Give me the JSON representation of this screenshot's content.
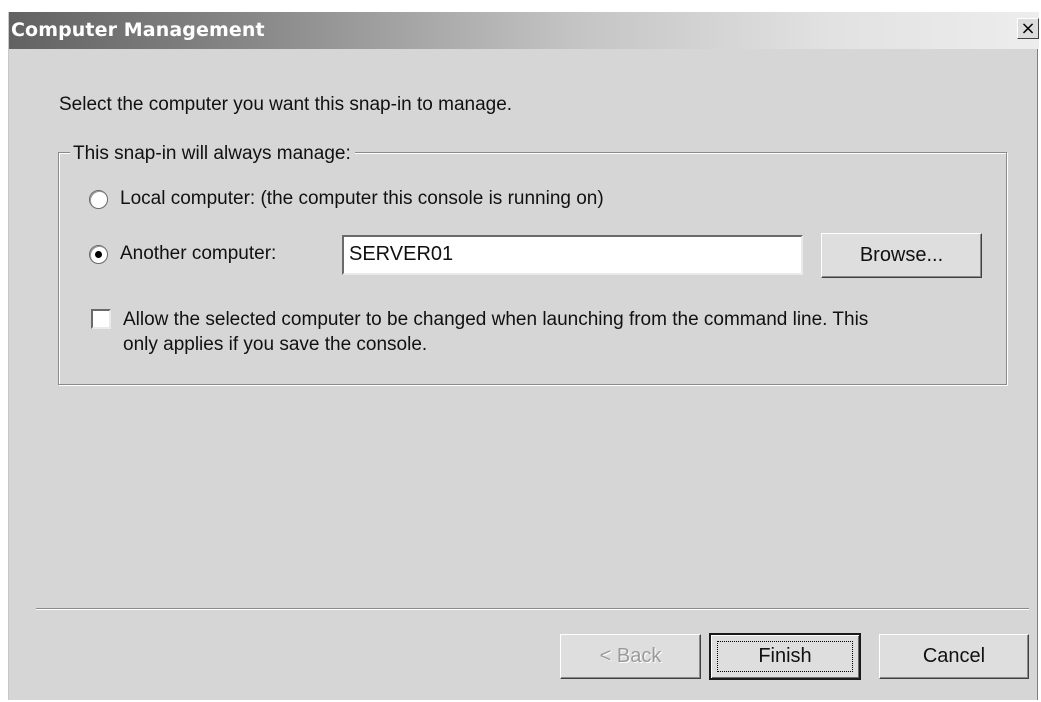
{
  "window": {
    "title": "Computer Management",
    "close_glyph": "×"
  },
  "instruction": "Select the computer you want this snap-in to manage.",
  "group": {
    "legend": "This snap-in will always manage:",
    "local_label": "Local computer:  (the computer this console is running on)",
    "local_selected": false,
    "another_label": "Another computer:",
    "another_selected": true,
    "computer_name": "SERVER01",
    "browse_label": "Browse...",
    "allow_change_line1": "Allow the selected computer to be changed when launching from the command line.  This",
    "allow_change_line2": "only applies if you save the console.",
    "allow_change_checked": false
  },
  "footer": {
    "back_label": "< Back",
    "finish_label": "Finish",
    "cancel_label": "Cancel"
  },
  "icons": {
    "close": "close-icon",
    "radio_selected": "radio-dot-icon"
  }
}
